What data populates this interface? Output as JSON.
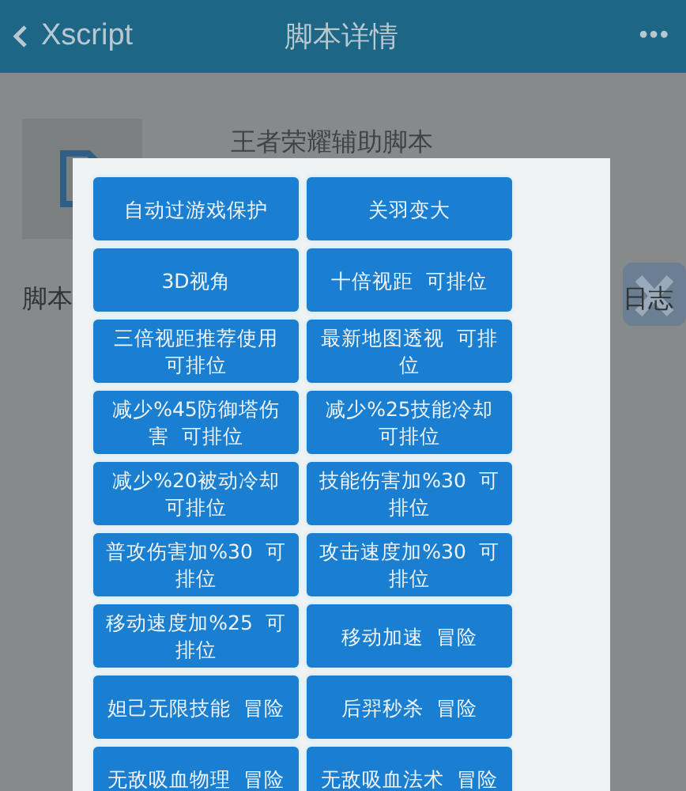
{
  "header": {
    "back_label": "Xscript",
    "title": "脚本详情",
    "menu": "•••"
  },
  "script": {
    "name": "王者荣耀辅助脚本"
  },
  "background_labels": [
    "脚本",
    "日志"
  ],
  "dialog": {
    "buttons": [
      {
        "lines": [
          "自动过游戏保护"
        ]
      },
      {
        "lines": [
          "关羽变大"
        ]
      },
      {
        "lines": [
          "3D视角"
        ]
      },
      {
        "lines": [
          "十倍视距  可排位"
        ]
      },
      {
        "lines": [
          "三倍视距推荐使用",
          "可排位"
        ]
      },
      {
        "lines": [
          "最新地图透视  可排",
          "位"
        ]
      },
      {
        "lines": [
          "减少%45防御塔伤",
          "害  可排位"
        ]
      },
      {
        "lines": [
          "减少%25技能冷却",
          "可排位"
        ]
      },
      {
        "lines": [
          "减少%20被动冷却",
          "可排位"
        ]
      },
      {
        "lines": [
          "技能伤害加%30  可",
          "排位"
        ]
      },
      {
        "lines": [
          "普攻伤害加%30  可",
          "排位"
        ]
      },
      {
        "lines": [
          "攻击速度加%30  可",
          "排位"
        ]
      },
      {
        "lines": [
          "移动速度加%25  可",
          "排位"
        ]
      },
      {
        "lines": [
          "移动加速  冒险"
        ]
      },
      {
        "lines": [
          "妲己无限技能  冒险"
        ]
      },
      {
        "lines": [
          "后羿秒杀  冒险"
        ]
      },
      {
        "lines": [
          "无敌吸血物理  冒险"
        ]
      },
      {
        "lines": [
          "无敌吸血法术  冒险"
        ]
      }
    ]
  }
}
